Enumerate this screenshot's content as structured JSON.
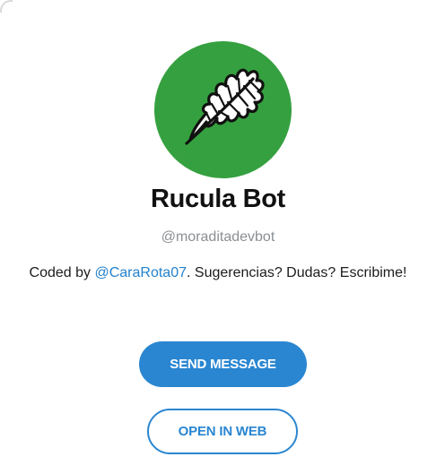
{
  "profile": {
    "name": "Rucula Bot",
    "username": "@moraditadevbot",
    "description_prefix": "Coded by ",
    "description_mention": "@CaraRota07",
    "description_suffix": ". Sugerencias? Dudas? Escribime!",
    "avatar_icon": "arugula-leaf-icon",
    "avatar_color": "#35a03f"
  },
  "actions": {
    "send_label": "SEND MESSAGE",
    "web_label": "OPEN IN WEB"
  },
  "colors": {
    "accent": "#2a86d1",
    "mention": "#2481cc"
  }
}
